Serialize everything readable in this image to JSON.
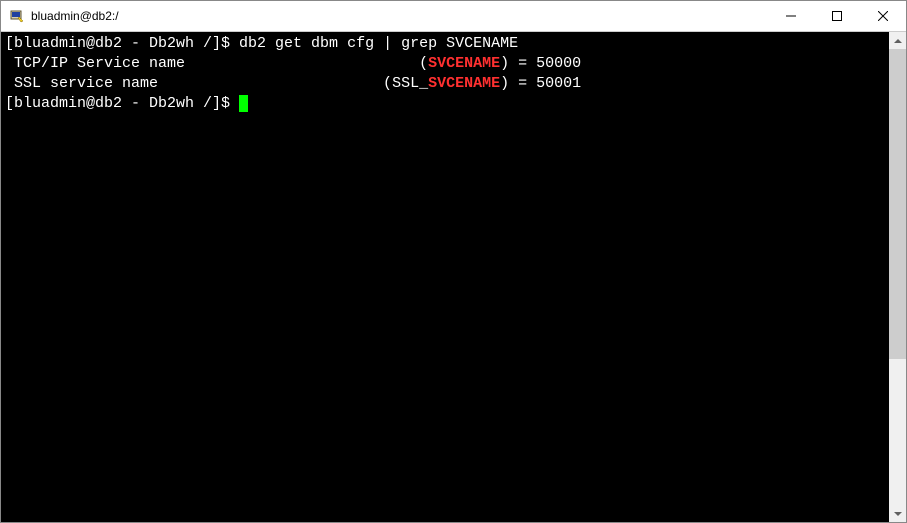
{
  "window": {
    "title": "bluadmin@db2:/"
  },
  "terminal": {
    "line1": {
      "prompt": "[bluadmin@db2 - Db2wh /]$ ",
      "command": "db2 get dbm cfg | grep SVCENAME"
    },
    "line2": {
      "label": " TCP/IP Service name                          (",
      "highlight": "SVCENAME",
      "rest": ") = 50000"
    },
    "line3": {
      "label": " SSL service name                         (SSL_",
      "highlight": "SVCENAME",
      "rest": ") = 50001"
    },
    "line4": {
      "prompt": "[bluadmin@db2 - Db2wh /]$ "
    }
  }
}
